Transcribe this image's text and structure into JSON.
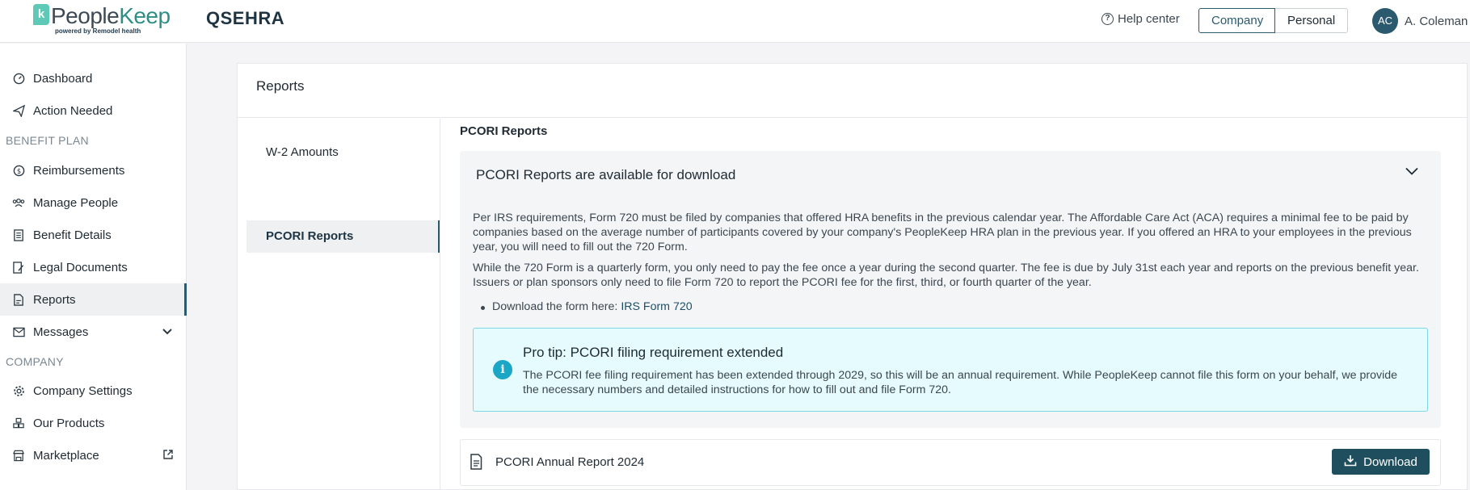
{
  "brand": {
    "logo_part1": "People",
    "logo_part2": "Keep",
    "logo_sub": "powered by Remodel health",
    "app_title": "QSEHRA"
  },
  "header": {
    "help_label": "Help center",
    "context_options": [
      "Company",
      "Personal"
    ],
    "context_selected": "Company",
    "user_initials": "AC",
    "user_name": "A. Coleman",
    "accent_color": "#2b5a6e"
  },
  "sidebar": {
    "items": [
      {
        "label": "Dashboard",
        "icon": "dashboard-gauge-icon"
      },
      {
        "label": "Action Needed",
        "icon": "paper-plane-icon"
      },
      {
        "label": "Reimbursements",
        "icon": "dollar-circle-icon"
      },
      {
        "label": "Manage People",
        "icon": "people-icon"
      },
      {
        "label": "Benefit Details",
        "icon": "list-document-icon"
      },
      {
        "label": "Legal Documents",
        "icon": "signed-document-icon"
      },
      {
        "label": "Reports",
        "icon": "report-document-icon"
      },
      {
        "label": "Messages",
        "icon": "envelope-icon"
      },
      {
        "label": "Company Settings",
        "icon": "gear-icon"
      },
      {
        "label": "Our Products",
        "icon": "products-icon"
      },
      {
        "label": "Marketplace",
        "icon": "store-icon"
      }
    ],
    "sections": [
      "BENEFIT PLAN",
      "COMPANY"
    ],
    "active_item": "Reports"
  },
  "main": {
    "card_title": "Reports",
    "subnav": [
      "W-2 Amounts",
      "PCORI Reports"
    ],
    "subnav_active": "PCORI Reports",
    "section_title": "PCORI Reports",
    "accordion": {
      "title": "PCORI Reports are available for download",
      "paragraph1": "Per IRS requirements, Form 720 must be filed by companies that offered HRA benefits in the previous calendar year. The Affordable Care Act (ACA) requires a minimal fee to be paid by companies based on the average number of participants covered by your company's PeopleKeep HRA plan in the previous year. If you offered an HRA to your employees in the previous year, you will need to fill out the 720 Form.",
      "paragraph2": "While the 720 Form is a quarterly form, you only need to pay the fee once a year during the second quarter. The fee is due by July 31st each year and reports on the previous benefit year. Issuers or plan sponsors only need to file Form 720 to report the PCORI fee for the first, third, or fourth quarter of the year.",
      "bullet_prefix": "Download the form here: ",
      "bullet_link": "IRS Form 720"
    },
    "tip": {
      "title": "Pro tip: PCORI filing requirement extended",
      "text": "The PCORI fee filing requirement has been extended through 2029, so this will be an annual requirement.  While PeopleKeep cannot file this form on your behalf, we provide the necessary numbers and detailed instructions for how to fill out and file Form 720."
    },
    "report": {
      "label": "PCORI Annual Report 2024",
      "download_label": "Download"
    }
  }
}
